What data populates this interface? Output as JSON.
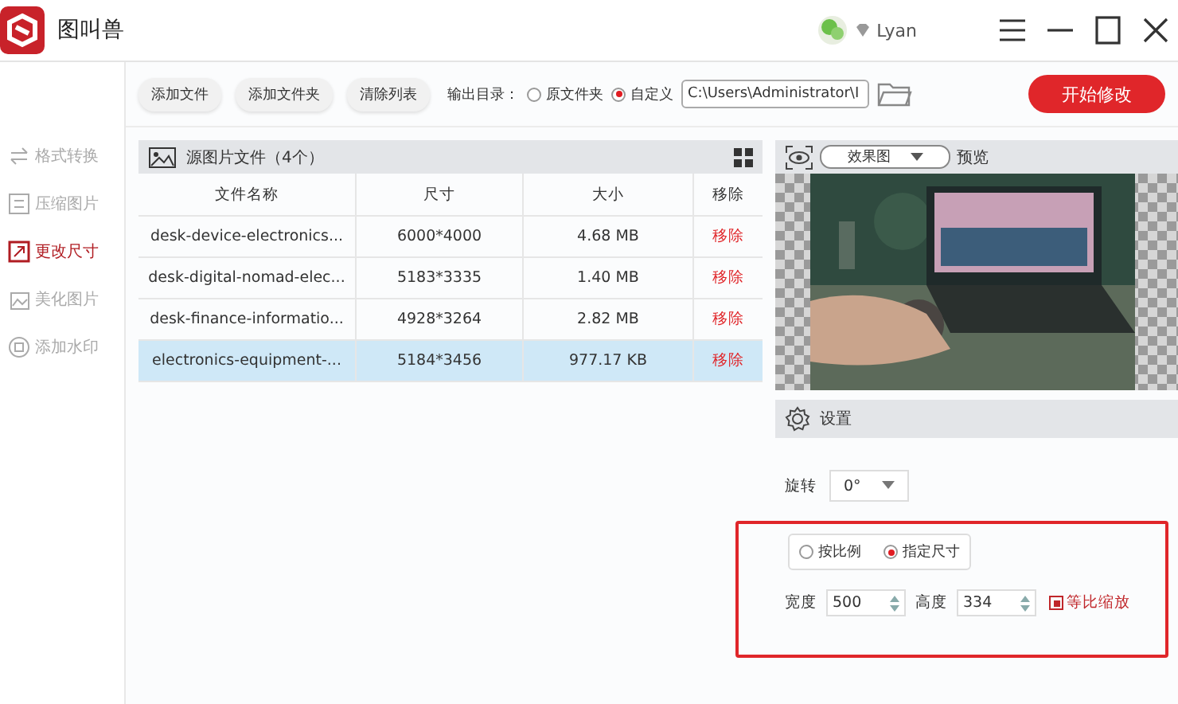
{
  "app": {
    "title": "图叫兽",
    "user": "Lyan"
  },
  "toolbar": {
    "buttons": [
      "添加文件",
      "添加文件夹",
      "清除列表"
    ],
    "output_label": "输出目录：",
    "output_options": [
      {
        "label": "原文件夹",
        "selected": false
      },
      {
        "label": "自定义",
        "selected": true
      }
    ],
    "path_value": "C:\\Users\\Administrator\\I",
    "start_button": "开始修改"
  },
  "sidebar": {
    "items": [
      {
        "label": "格式转换",
        "selected": false
      },
      {
        "label": "压缩图片",
        "selected": false
      },
      {
        "label": "更改尺寸",
        "selected": true
      },
      {
        "label": "美化图片",
        "selected": false
      },
      {
        "label": "添加水印",
        "selected": false
      }
    ]
  },
  "file_panel": {
    "title": "源图片文件（4个）",
    "columns": [
      "文件名称",
      "尺寸",
      "大小",
      "移除"
    ],
    "rows": [
      {
        "name": "desk-device-electronics...",
        "dimensions": "6000*4000",
        "size": "4.68 MB",
        "remove": "移除",
        "selected": false
      },
      {
        "name": "desk-digital-nomad-elec...",
        "dimensions": "5183*3335",
        "size": "1.40 MB",
        "remove": "移除",
        "selected": false
      },
      {
        "name": "desk-finance-informatio...",
        "dimensions": "4928*3264",
        "size": "2.82 MB",
        "remove": "移除",
        "selected": false
      },
      {
        "name": "electronics-equipment-...",
        "dimensions": "5184*3456",
        "size": "977.17 KB",
        "remove": "移除",
        "selected": true
      }
    ]
  },
  "preview": {
    "mode": "效果图",
    "label": "预览"
  },
  "settings": {
    "title": "设置",
    "rotation_label": "旋转",
    "rotation_value": "0°",
    "scale_options": [
      {
        "label": "按比例",
        "selected": false
      },
      {
        "label": "指定尺寸",
        "selected": true
      }
    ],
    "width_label": "宽度",
    "width_value": "500",
    "height_label": "高度",
    "height_value": "334",
    "proportional": {
      "label": "等比缩放",
      "checked": true
    }
  }
}
